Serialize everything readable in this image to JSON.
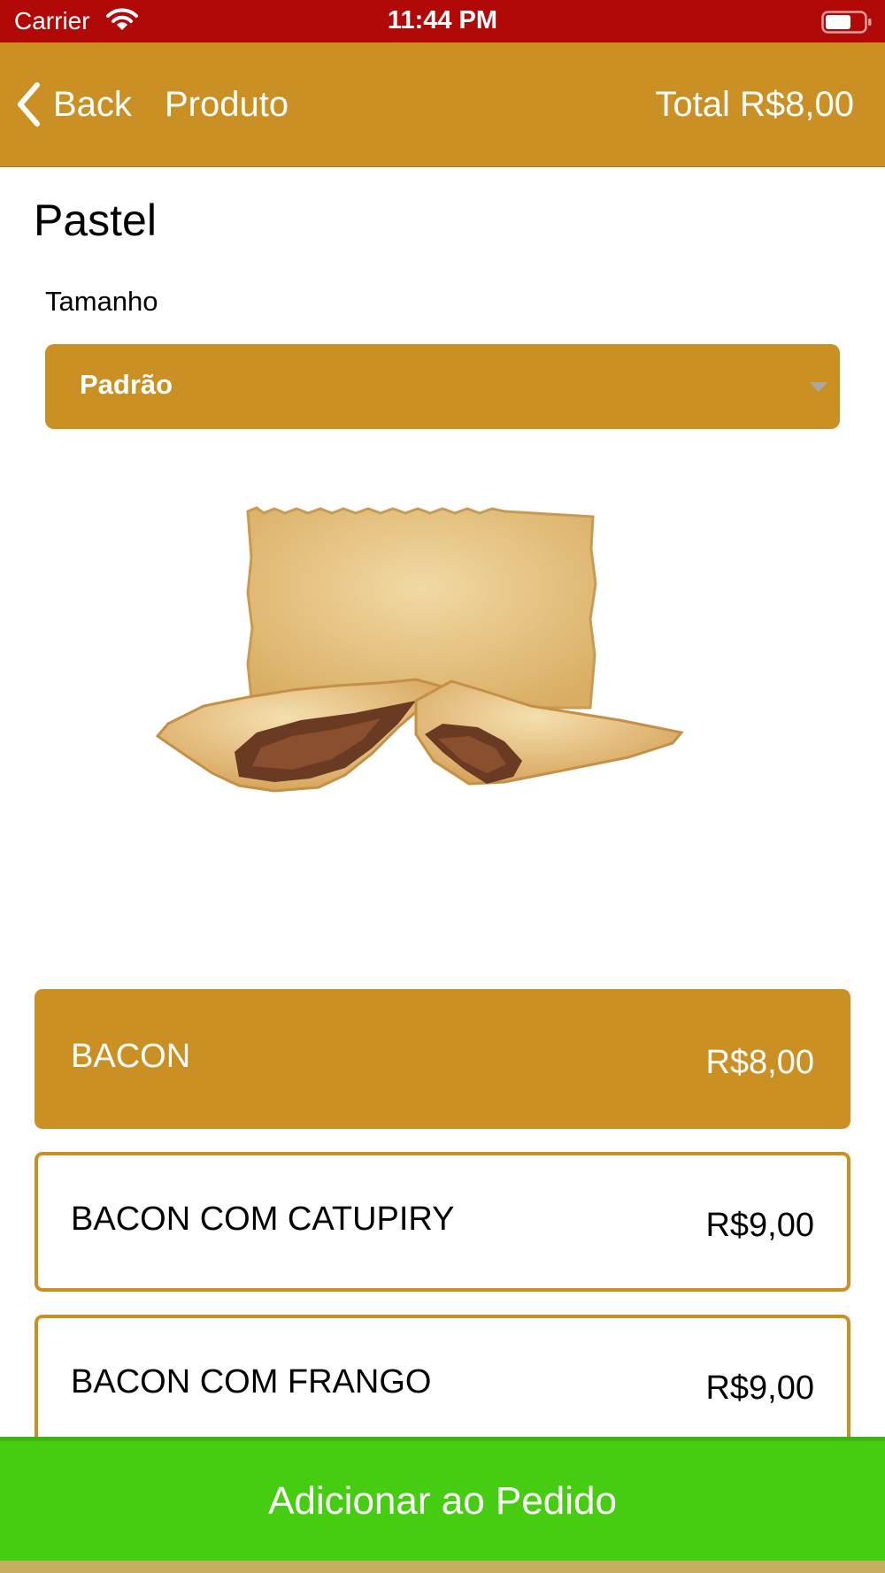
{
  "status_bar": {
    "carrier": "Carrier",
    "time": "11:44 PM"
  },
  "nav": {
    "back_label": "Back",
    "title": "Produto",
    "total": "Total R$8,00"
  },
  "product": {
    "name": "Pastel",
    "size_label": "Tamanho",
    "size_selected": "Padrão"
  },
  "options": [
    {
      "name": "BACON",
      "price": "R$8,00",
      "selected": true
    },
    {
      "name": "BACON COM CATUPIRY",
      "price": "R$9,00",
      "selected": false
    },
    {
      "name": "BACON COM FRANGO",
      "price": "R$9,00",
      "selected": false
    }
  ],
  "add_button": {
    "label": "Adicionar ao Pedido"
  },
  "colors": {
    "status_bar": "#b10808",
    "brand": "#cb9023",
    "add_button": "#46cc11"
  },
  "icons": {
    "back": "chevron-left-icon",
    "wifi": "wifi-icon",
    "battery": "battery-icon",
    "dropdown": "chevron-down-icon"
  }
}
